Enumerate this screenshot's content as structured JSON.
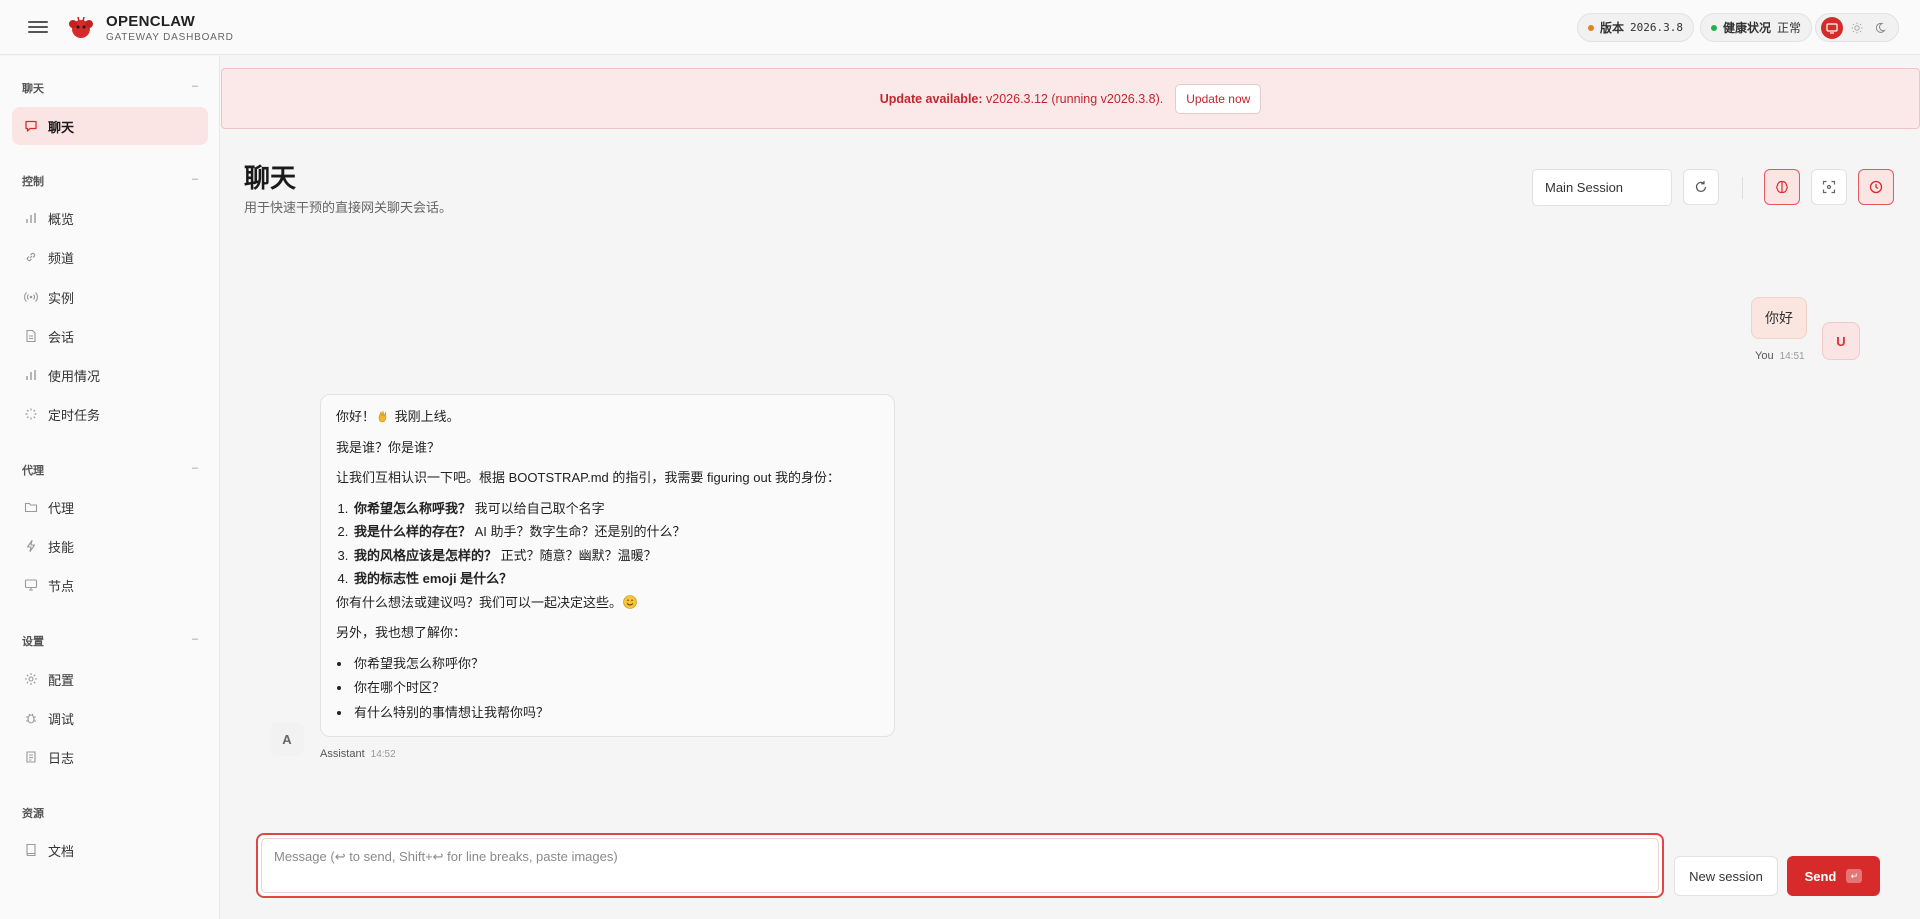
{
  "header": {
    "brand_name": "OPENCLAW",
    "brand_sub": "GATEWAY DASHBOARD",
    "version_label": "版本",
    "version_value": "2026.3.8",
    "health_label": "健康状况",
    "health_value": "正常"
  },
  "sidebar": {
    "sections": {
      "chat": "聊天",
      "control": "控制",
      "agent": "代理",
      "settings": "设置",
      "resources": "资源"
    },
    "items": {
      "chat": "聊天",
      "overview": "概览",
      "channels": "频道",
      "instances": "实例",
      "sessions": "会话",
      "usage": "使用情况",
      "cron": "定时任务",
      "agents": "代理",
      "skills": "技能",
      "nodes": "节点",
      "config": "配置",
      "debug": "调试",
      "logs": "日志",
      "docs": "文档"
    },
    "collapse_symbol": "–"
  },
  "banner": {
    "label": "Update available:",
    "text": " v2026.3.12 (running v2026.3.8).",
    "button": "Update now"
  },
  "page": {
    "title": "聊天",
    "subtitle": "用于快速干预的直接网关聊天会话。",
    "session": "Main Session"
  },
  "chat": {
    "user_message": "你好",
    "user_avatar": "U",
    "user_name": "You",
    "user_time": "14:51",
    "assistant_avatar": "A",
    "assistant_name": "Assistant",
    "assistant_time": "14:52",
    "assistant": {
      "line1": "你好！",
      "line1_tail": " 我刚上线。",
      "line2": "我是谁？你是谁？",
      "line3": "让我们互相认识一下吧。根据 BOOTSTRAP.md 的指引，我需要 figuring out 我的身份：",
      "q1_bold": "你希望怎么称呼我？",
      "q1_rest": " 我可以给自己取个名字",
      "q2_bold": "我是什么样的存在？",
      "q2_rest": " AI 助手？数字生命？还是别的什么？",
      "q3_bold": "我的风格应该是怎样的？",
      "q3_rest": " 正式？随意？幽默？温暖？",
      "q4_bold": "我的标志性 emoji 是什么？",
      "line4": "你有什么想法或建议吗？我们可以一起决定这些。",
      "line5": "另外，我也想了解你：",
      "b1": "你希望我怎么称呼你？",
      "b2": "你在哪个时区？",
      "b3": "有什么特别的事情想让我帮你吗？"
    }
  },
  "composer": {
    "placeholder": "Message (↩ to send, Shift+↩ for line breaks, paste images)",
    "new_session": "New session",
    "send": "Send",
    "send_kbd": "↵"
  },
  "colors": {
    "accent": "#d72b2b",
    "status_version": "#e0821e",
    "status_health": "#22b14c"
  }
}
